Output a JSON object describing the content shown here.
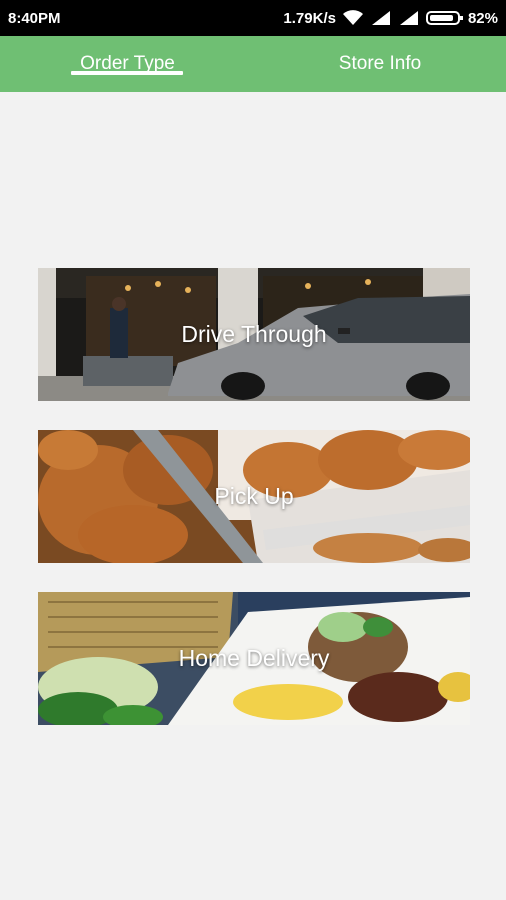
{
  "status_bar": {
    "time": "8:40PM",
    "network_speed": "1.79K/s",
    "battery": "82%",
    "icons": [
      "wifi-icon",
      "signal-icon",
      "signal-icon",
      "battery-icon"
    ]
  },
  "tabs": [
    {
      "label": "Order Type",
      "selected": true
    },
    {
      "label": "Store Info",
      "selected": false
    }
  ],
  "order_options": [
    {
      "label": "Drive Through"
    },
    {
      "label": "Pick Up"
    },
    {
      "label": "Home Delivery"
    }
  ],
  "colors": {
    "tab_bar": "#6fbf73",
    "background": "#f2f2f2",
    "status_bar": "#000000"
  }
}
